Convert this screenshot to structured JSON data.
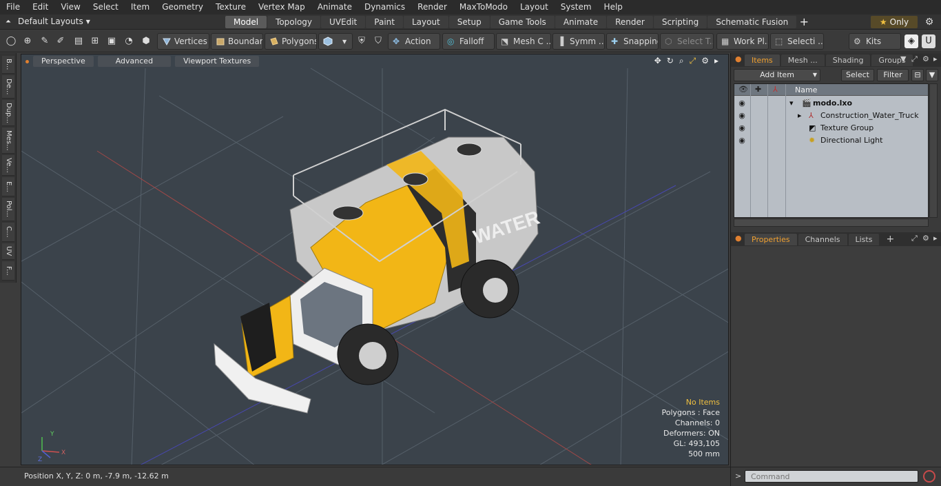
{
  "menu": [
    "File",
    "Edit",
    "View",
    "Select",
    "Item",
    "Geometry",
    "Texture",
    "Vertex Map",
    "Animate",
    "Dynamics",
    "Render",
    "MaxToModo",
    "Layout",
    "System",
    "Help"
  ],
  "layouts": {
    "label": "Default Layouts"
  },
  "tabs": [
    "Model",
    "Topology",
    "UVEdit",
    "Paint",
    "Layout",
    "Setup",
    "Game Tools",
    "Animate",
    "Render",
    "Scripting",
    "Schematic Fusion"
  ],
  "active_tab": "Model",
  "only_label": "Only",
  "toolbar": {
    "vertices": "Vertices",
    "boundary": "Boundary",
    "polygons": "Polygons",
    "action": "Action",
    "falloff": "Falloff",
    "meshc": "Mesh C ...",
    "symm": "Symm ...",
    "snapping": "Snapping",
    "select_t": "Select T...",
    "work_pl": "Work Pl...",
    "selecti": "Selecti ...",
    "kits": "Kits"
  },
  "left_strip": [
    "B...",
    "De...",
    "Dup...",
    "Mes...",
    "Ve...",
    "E...",
    "Pol...",
    "C...",
    "UV",
    "F..."
  ],
  "viewport": {
    "perspective": "Perspective",
    "advanced": "Advanced",
    "viewport_textures": "Viewport Textures",
    "truck_text": "WATER",
    "stats": {
      "no_items": "No Items",
      "polygons": "Polygons : Face",
      "channels": "Channels: 0",
      "deformers": "Deformers: ON",
      "gl": "GL: 493,105",
      "scale": "500 mm"
    },
    "axis_labels": {
      "y": "Y",
      "x": "X",
      "z": "Z"
    }
  },
  "status": {
    "position": "Position X, Y, Z:   0 m, -7.9 m, -12.62 m"
  },
  "items_panel": {
    "tabs": [
      "Items",
      "Mesh ...",
      "Shading",
      "Groups"
    ],
    "active_tab": "Items",
    "add_item": "Add Item",
    "select": "Select",
    "filter": "Filter",
    "column_name": "Name",
    "rows": [
      {
        "label": "modo.lxo",
        "icon": "scene-icon"
      },
      {
        "label": "Construction_Water_Truck",
        "icon": "mesh-icon"
      },
      {
        "label": "Texture Group",
        "icon": "texture-group-icon"
      },
      {
        "label": "Directional Light",
        "icon": "light-icon"
      }
    ]
  },
  "props_panel": {
    "tabs": [
      "Properties",
      "Channels",
      "Lists"
    ],
    "active_tab": "Properties"
  },
  "command": {
    "placeholder": "Command"
  },
  "colors": {
    "accent": "#f0a030",
    "viewport_bg": "#3b434b",
    "truck_yellow": "#f2b616"
  }
}
